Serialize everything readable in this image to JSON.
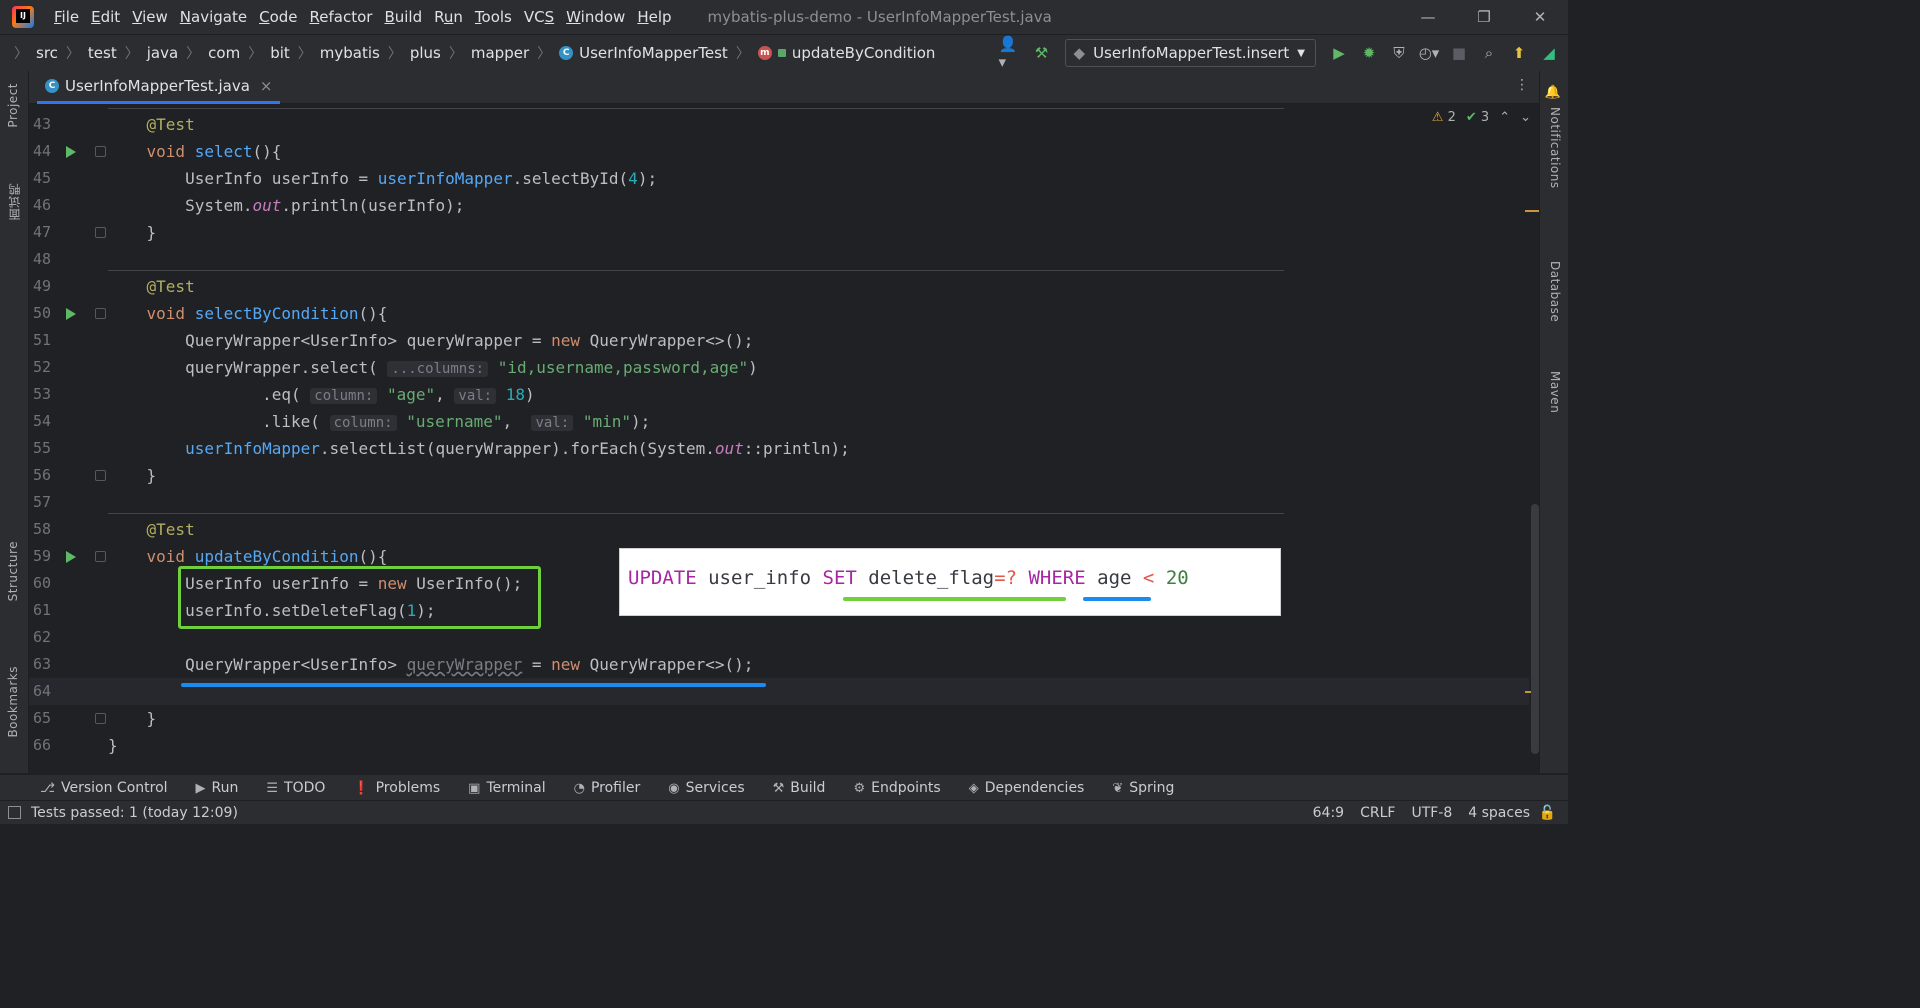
{
  "titlebar": {
    "menu": [
      {
        "pre": "",
        "u": "F",
        "post": "ile"
      },
      {
        "pre": "",
        "u": "E",
        "post": "dit"
      },
      {
        "pre": "",
        "u": "V",
        "post": "iew"
      },
      {
        "pre": "",
        "u": "N",
        "post": "avigate"
      },
      {
        "pre": "",
        "u": "C",
        "post": "ode"
      },
      {
        "pre": "",
        "u": "R",
        "post": "efactor"
      },
      {
        "pre": "",
        "u": "B",
        "post": "uild"
      },
      {
        "pre": "R",
        "u": "u",
        "post": "n"
      },
      {
        "pre": "",
        "u": "T",
        "post": "ools"
      },
      {
        "pre": "VC",
        "u": "S",
        "post": ""
      },
      {
        "pre": "",
        "u": "W",
        "post": "indow"
      },
      {
        "pre": "",
        "u": "H",
        "post": "elp"
      }
    ],
    "window_title": "mybatis-plus-demo - UserInfoMapperTest.java",
    "controls": {
      "minimize": "—",
      "restore": "❐",
      "close": "✕"
    }
  },
  "breadcrumbs": [
    "src",
    "test",
    "java",
    "com",
    "bit",
    "mybatis",
    "plus",
    "mapper",
    "UserInfoMapperTest",
    "updateByCondition"
  ],
  "run_config": "UserInfoMapperTest.insert",
  "file_tab": {
    "name": "UserInfoMapperTest.java",
    "close": "×"
  },
  "left_stripe": {
    "project": "Project",
    "cn_tool": "面试鸭",
    "structure": "Structure",
    "bookmarks": "Bookmarks"
  },
  "right_stripe": {
    "notifications": "Notifications",
    "database": "Database",
    "maven": "Maven"
  },
  "inspections": {
    "warnings": "2",
    "typos": "3"
  },
  "editor": {
    "lines": [
      {
        "n": "43",
        "run": false,
        "fold": false,
        "html": "    <span class='ann'>@Test</span>"
      },
      {
        "n": "44",
        "run": true,
        "fold": true,
        "html": "    <span class='kw'>void</span> <span class='fn'>select</span>(){"
      },
      {
        "n": "45",
        "run": false,
        "fold": false,
        "html": "        UserInfo userInfo = <span class='field-ref'>userInfoMapper</span>.selectById(<span class='num'>4</span>);"
      },
      {
        "n": "46",
        "run": false,
        "fold": false,
        "html": "        System.<span class='stat'>out</span>.println(userInfo);"
      },
      {
        "n": "47",
        "run": false,
        "fold": true,
        "html": "    }"
      },
      {
        "n": "48",
        "run": false,
        "fold": false,
        "html": ""
      },
      {
        "n": "49",
        "run": false,
        "fold": false,
        "html": "    <span class='ann'>@Test</span>"
      },
      {
        "n": "50",
        "run": true,
        "fold": true,
        "html": "    <span class='kw'>void</span> <span class='fn'>selectByCondition</span>(){"
      },
      {
        "n": "51",
        "run": false,
        "fold": false,
        "html": "        QueryWrapper&lt;UserInfo&gt; queryWrapper = <span class='kw'>new</span> QueryWrapper&lt;&gt;();"
      },
      {
        "n": "52",
        "run": false,
        "fold": false,
        "html": "        queryWrapper.select( <span class='hint'>...columns:</span> <span class='str'>\"id,username,password,age\"</span>)"
      },
      {
        "n": "53",
        "run": false,
        "fold": false,
        "html": "                .eq( <span class='hint'>column:</span> <span class='str'>\"age\"</span>, <span class='hint'>val:</span> <span class='num'>18</span>)"
      },
      {
        "n": "54",
        "run": false,
        "fold": false,
        "html": "                .like( <span class='hint'>column:</span> <span class='str'>\"username\"</span>,  <span class='hint'>val:</span> <span class='str'>\"min\"</span>);"
      },
      {
        "n": "55",
        "run": false,
        "fold": false,
        "html": "        <span class='field-ref'>userInfoMapper</span>.selectList(queryWrapper).forEach(System.<span class='stat'>out</span>::println);"
      },
      {
        "n": "56",
        "run": false,
        "fold": true,
        "html": "    }"
      },
      {
        "n": "57",
        "run": false,
        "fold": false,
        "html": ""
      },
      {
        "n": "58",
        "run": false,
        "fold": false,
        "html": "    <span class='ann'>@Test</span>"
      },
      {
        "n": "59",
        "run": true,
        "fold": true,
        "html": "    <span class='kw'>void</span> <span class='fn'>updateByCondition</span>(){"
      },
      {
        "n": "60",
        "run": false,
        "fold": false,
        "html": "        UserInfo userInfo = <span class='kw'>new</span> UserInfo();"
      },
      {
        "n": "61",
        "run": false,
        "fold": false,
        "html": "        userInfo.setDeleteFlag(<span class='num'>1</span>);"
      },
      {
        "n": "62",
        "run": false,
        "fold": false,
        "html": ""
      },
      {
        "n": "63",
        "run": false,
        "fold": false,
        "html": "        QueryWrapper&lt;UserInfo&gt; <span class='unused'>queryWrapper</span> = <span class='kw'>new</span> QueryWrapper&lt;&gt;();"
      },
      {
        "n": "64",
        "run": false,
        "fold": false,
        "html": "",
        "current": true
      },
      {
        "n": "65",
        "run": false,
        "fold": true,
        "html": "    }"
      },
      {
        "n": "66",
        "run": false,
        "fold": false,
        "html": "}"
      }
    ]
  },
  "sql_overlay": {
    "update": "UPDATE",
    "table": "user_info",
    "set": "SET",
    "col": "delete_flag",
    "eq": "=?",
    "where": "WHERE",
    "age": "age",
    "lt": "<",
    "val": "20"
  },
  "tool_windows": [
    {
      "icon": "⎇",
      "label": "Version Control"
    },
    {
      "icon": "▶",
      "label": "Run"
    },
    {
      "icon": "☰",
      "label": "TODO"
    },
    {
      "icon": "❗",
      "label": "Problems"
    },
    {
      "icon": "▣",
      "label": "Terminal"
    },
    {
      "icon": "◔",
      "label": "Profiler"
    },
    {
      "icon": "◉",
      "label": "Services"
    },
    {
      "icon": "⚒",
      "label": "Build"
    },
    {
      "icon": "⚙",
      "label": "Endpoints"
    },
    {
      "icon": "◈",
      "label": "Dependencies"
    },
    {
      "icon": "❦",
      "label": "Spring"
    }
  ],
  "status": {
    "message": "Tests passed: 1 (today 12:09)",
    "position": "64:9",
    "line_sep": "CRLF",
    "encoding": "UTF-8",
    "indent": "4 spaces"
  }
}
